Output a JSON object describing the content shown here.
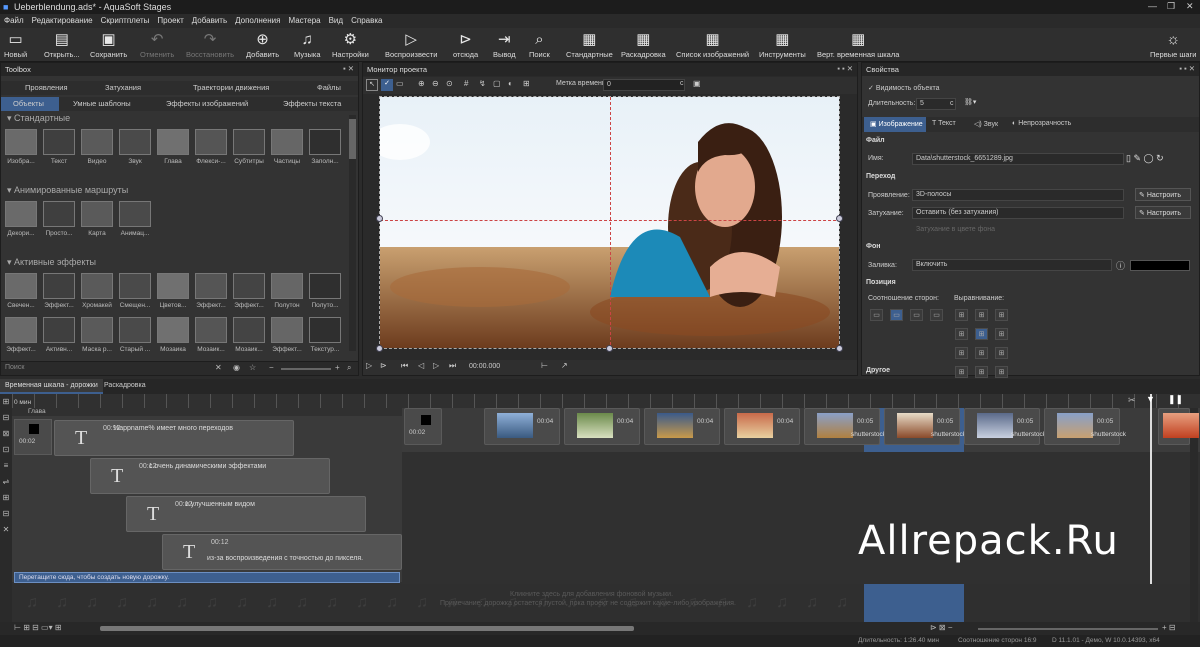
{
  "window": {
    "title": "Ueberblendung.ads* - AquaSoft Stages"
  },
  "menu": [
    "Файл",
    "Редактирование",
    "Скриптплеты",
    "Проект",
    "Добавить",
    "Дополнения",
    "Мастера",
    "Вид",
    "Справка"
  ],
  "toolbar": {
    "new": "Новый",
    "open": "Открыть...",
    "save": "Сохранить",
    "undo": "Отменить",
    "redo": "Восстановить",
    "add": "Добавить",
    "music": "Музыка",
    "settings": "Настройки",
    "play": "Воспроизвести",
    "from_here": "отсюда",
    "output": "Вывод",
    "search": "Поиск",
    "standard": "Стандартные",
    "storyboard": "Раскадровка",
    "image_list": "Список изображений",
    "tools": "Инструменты",
    "vert_timeline": "Верт. временная шкала",
    "first_steps": "Первые шаги"
  },
  "toolbox": {
    "title": "Toolbox",
    "tabs_row1": [
      "Проявления",
      "Затухания",
      "Траектории движения",
      "Файлы"
    ],
    "tabs_row2": [
      "Объекты",
      "Умные шаблоны",
      "Эффекты изображений",
      "Эффекты текста"
    ],
    "sec1": "Стандартные",
    "items1": [
      "Изобра...",
      "Текст",
      "Видео",
      "Звук",
      "Глава",
      "Флекси-...",
      "Субтитры",
      "Частицы",
      "Заполн..."
    ],
    "sec2": "Анимированные маршруты",
    "items2": [
      "Декори...",
      "Просто...",
      "Карта",
      "Анимац..."
    ],
    "sec3": "Активные эффекты",
    "items3": [
      "Свечен...",
      "Эффект...",
      "Хромакей",
      "Смещен...",
      "Цветов...",
      "Эффект...",
      "Эффект...",
      "Полутон",
      "Полуто..."
    ],
    "items4": [
      "Эффект...",
      "Активн...",
      "Маска р...",
      "Старый ...",
      "Мозаика",
      "Мозаик...",
      "Мозаик...",
      "Эффект...",
      "Текстур..."
    ],
    "search_placeholder": "Поиск"
  },
  "monitor": {
    "title": "Монитор проекта",
    "timestamp_label": "Метка времени:",
    "timestamp_value": "0",
    "unit": "с",
    "time": "00:00.000"
  },
  "properties": {
    "title": "Свойства",
    "visibility": "Видимость объекта",
    "duration_label": "Длительность:",
    "duration_value": "5",
    "duration_unit": "с",
    "tabs": [
      "Изображение",
      "Текст",
      "Звук",
      "Непрозрачность"
    ],
    "file_head": "Файл",
    "name_label": "Имя:",
    "name_value": "Data\\shutterstock_6651289.jpg",
    "transition_head": "Переход",
    "appear_label": "Проявление:",
    "appear_value": "3D-полосы",
    "fade_label": "Затухание:",
    "fade_value": "Оставить (без затухания)",
    "configure": "Настроить",
    "fade_color": "Затухание в цвете фона",
    "bg_head": "Фон",
    "fill_label": "Заливка:",
    "fill_value": "Включить",
    "pos_head": "Позиция",
    "aspect_label": "Соотношение сторон:",
    "align_label": "Выравнивание:",
    "other_head": "Другое"
  },
  "timeline": {
    "tabs": [
      "Временная шкала - дорожки",
      "Раскадровка"
    ],
    "ruler_start": "0 мин",
    "chapter": "Глава",
    "clips": [
      {
        "d": "00:02",
        "s": ""
      },
      {
        "d": "00:04",
        "s": ""
      },
      {
        "d": "00:04",
        "s": ""
      },
      {
        "d": "00:04",
        "s": ""
      },
      {
        "d": "00:04",
        "s": ""
      },
      {
        "d": "00:05",
        "s": "shutterstock"
      },
      {
        "d": "00:05",
        "s": "shutterstock"
      },
      {
        "d": "00:05",
        "s": "shutterstock"
      },
      {
        "d": "00:05",
        "s": "shutterstock"
      }
    ],
    "text_clips": [
      {
        "d": "00:12",
        "c": "%appname% имеет много переходов"
      },
      {
        "d": "00:12",
        "c": "с очень динамическими эффектами"
      },
      {
        "d": "00:12",
        "c": "и улучшенным видом"
      },
      {
        "d": "00:12",
        "c": "из-за воспроизведения с точностью до пикселя."
      }
    ],
    "first_clip_d": "00:02",
    "drag_hint": "Перетащите сюда, чтобы создать новую дорожку.",
    "music_hint1": "Кликните здесь для добавления фоновой музыки.",
    "music_hint2": "Примечание: дорожка остается пустой, пока проект не содержит какие-либо изображения."
  },
  "watermark": "Allrepack.Ru",
  "statusbar": {
    "duration": "Длительность: 1:26.40 мин",
    "aspect": "Соотношение сторон 16:9",
    "version": "D 11.1.01 - Демо, W 10.0.14393, x64"
  },
  "colors": {
    "accent": "#3d5f8f",
    "selection": "#4a6ea3",
    "panel": "#333333"
  }
}
